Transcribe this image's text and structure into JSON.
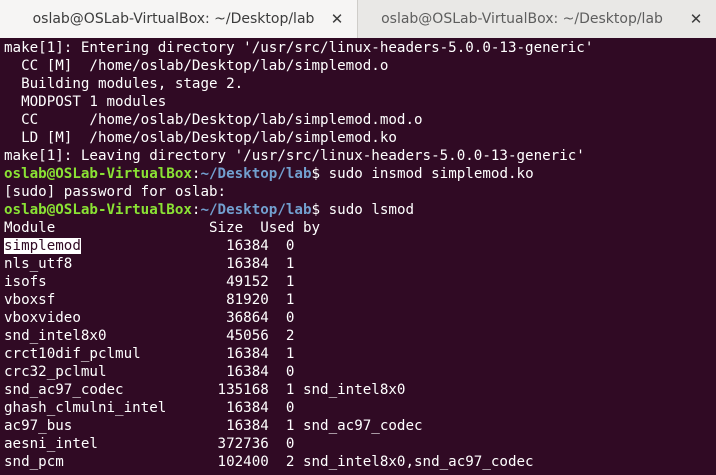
{
  "tabs": [
    {
      "label": "oslab@OSLab-VirtualBox: ~/Desktop/lab",
      "close": "✕"
    },
    {
      "label": "oslab@OSLab-VirtualBox: ~/Desktop/lab",
      "close": "✕"
    }
  ],
  "terminal": {
    "make_lines": [
      "make[1]: Entering directory '/usr/src/linux-headers-5.0.0-13-generic'",
      "  CC [M]  /home/oslab/Desktop/lab/simplemod.o",
      "  Building modules, stage 2.",
      "  MODPOST 1 modules",
      "  CC      /home/oslab/Desktop/lab/simplemod.mod.o",
      "  LD [M]  /home/oslab/Desktop/lab/simplemod.ko",
      "make[1]: Leaving directory '/usr/src/linux-headers-5.0.0-13-generic'"
    ],
    "prompt_user": "oslab@OSLab-VirtualBox",
    "prompt_sep": ":",
    "prompt_path": "~/Desktop/lab",
    "prompt_end": "$ ",
    "cmd1": "sudo insmod simplemod.ko",
    "sudo_prompt": "[sudo] password for oslab:",
    "cmd2": "sudo lsmod",
    "header": "Module                  Size  Used by",
    "rows": [
      {
        "name": "simplemod",
        "rest": "                 16384  0"
      },
      {
        "name": "nls_utf8",
        "rest": "                  16384  1"
      },
      {
        "name": "isofs",
        "rest": "                     49152  1"
      },
      {
        "name": "vboxsf",
        "rest": "                    81920  1"
      },
      {
        "name": "vboxvideo",
        "rest": "                 36864  0"
      },
      {
        "name": "snd_intel8x0",
        "rest": "              45056  2"
      },
      {
        "name": "crct10dif_pclmul",
        "rest": "          16384  1"
      },
      {
        "name": "crc32_pclmul",
        "rest": "              16384  0"
      },
      {
        "name": "snd_ac97_codec",
        "rest": "           135168  1 snd_intel8x0"
      },
      {
        "name": "ghash_clmulni_intel",
        "rest": "       16384  0"
      },
      {
        "name": "ac97_bus",
        "rest": "                  16384  1 snd_ac97_codec"
      },
      {
        "name": "aesni_intel",
        "rest": "              372736  0"
      },
      {
        "name": "snd_pcm",
        "rest": "                  102400  2 snd_intel8x0,snd_ac97_codec"
      }
    ]
  },
  "colors": {
    "terminal_bg": "#300a24",
    "prompt_user": "#8ae234",
    "prompt_path": "#729fcf",
    "text": "#ffffff"
  }
}
